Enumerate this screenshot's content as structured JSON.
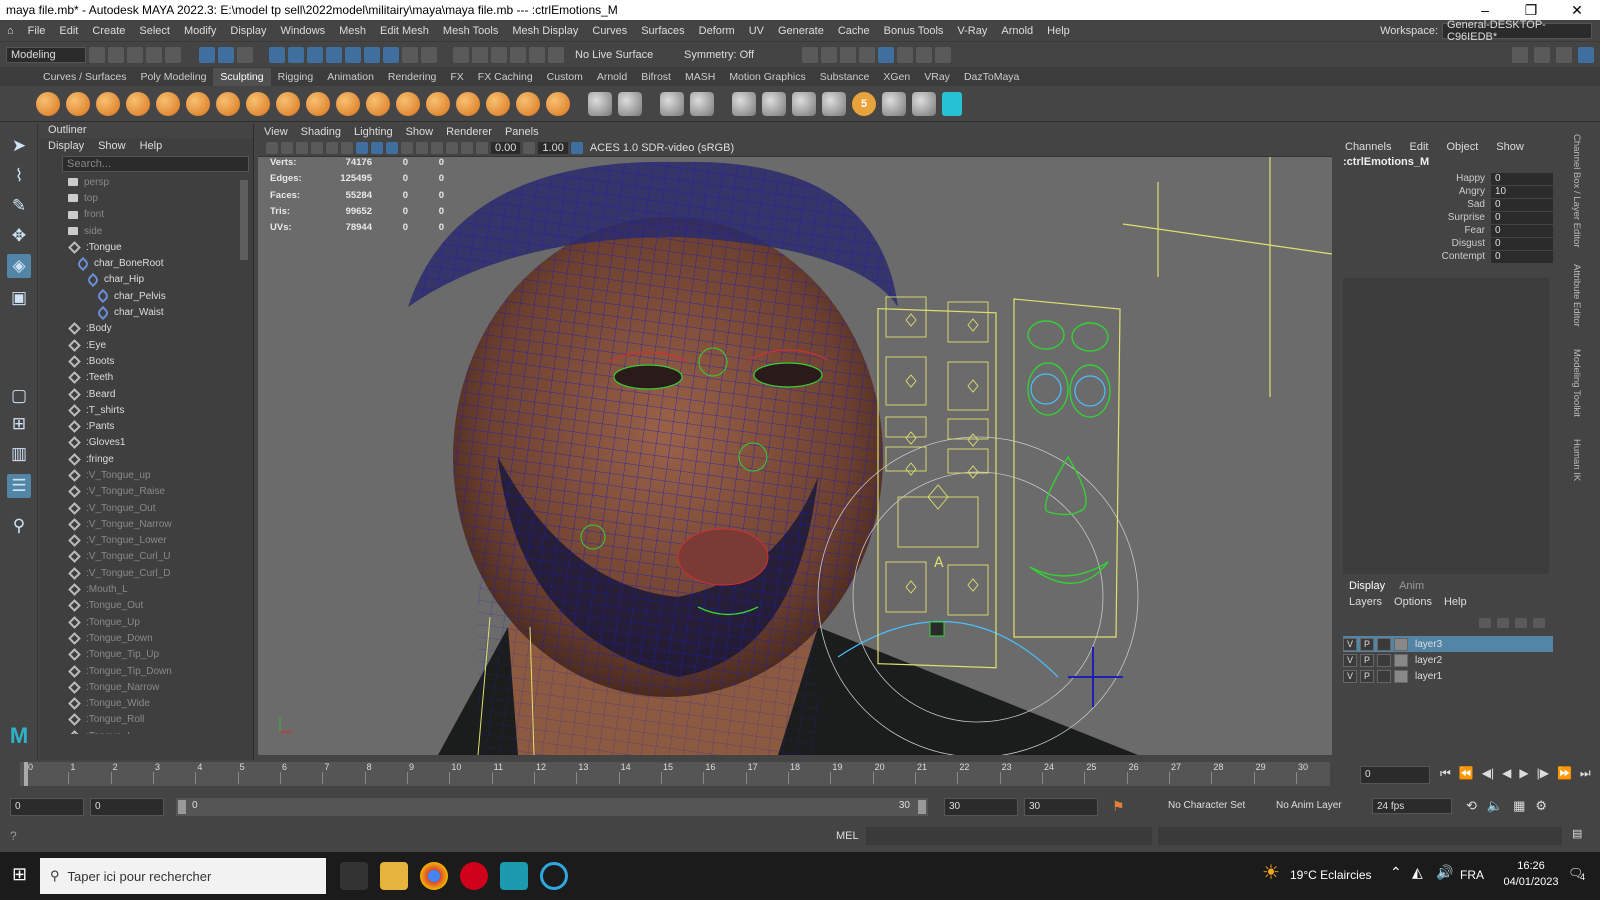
{
  "window": {
    "title": "maya file.mb* - Autodesk MAYA 2022.3: E:\\model tp sell\\2022model\\militairy\\maya\\maya file.mb   ---   :ctrlEmotions_M"
  },
  "menu": [
    "File",
    "Edit",
    "Create",
    "Select",
    "Modify",
    "Display",
    "Windows",
    "Mesh",
    "Edit Mesh",
    "Mesh Tools",
    "Mesh Display",
    "Curves",
    "Surfaces",
    "Deform",
    "UV",
    "Generate",
    "Cache",
    "Bonus Tools",
    "V-Ray",
    "Arnold",
    "Help"
  ],
  "workspace": {
    "label": "Workspace:",
    "value": "General-DESKTOP-C96IEDB*"
  },
  "status": {
    "mode": "Modeling",
    "live_surface": "No Live Surface",
    "symmetry": "Symmetry: Off"
  },
  "shelf_tabs": [
    "Curves / Surfaces",
    "Poly Modeling",
    "Sculpting",
    "Rigging",
    "Animation",
    "Rendering",
    "FX",
    "FX Caching",
    "Custom",
    "Arnold",
    "Bifrost",
    "MASH",
    "Motion Graphics",
    "Substance",
    "XGen",
    "VRay",
    "DazToMaya"
  ],
  "outliner": {
    "title": "Outliner",
    "menu": [
      "Display",
      "Show",
      "Help"
    ],
    "search_placeholder": "Search...",
    "items": [
      {
        "label": "persp",
        "icon": "camera-icon",
        "dim": true,
        "indent": 0
      },
      {
        "label": "top",
        "icon": "camera-icon",
        "dim": true,
        "indent": 0
      },
      {
        "label": "front",
        "icon": "camera-icon",
        "dim": true,
        "indent": 0
      },
      {
        "label": "side",
        "icon": "camera-icon",
        "dim": true,
        "indent": 0
      },
      {
        "label": ":Tongue",
        "icon": "mesh-icon",
        "dim": false,
        "indent": 0
      },
      {
        "label": "char_BoneRoot",
        "icon": "joint-icon",
        "dim": false,
        "indent": 1
      },
      {
        "label": "char_Hip",
        "icon": "joint-icon",
        "dim": false,
        "indent": 2
      },
      {
        "label": "char_Pelvis",
        "icon": "joint-icon",
        "dim": false,
        "indent": 3
      },
      {
        "label": "char_Waist",
        "icon": "joint-icon",
        "dim": false,
        "indent": 3
      },
      {
        "label": ":Body",
        "icon": "mesh-icon",
        "dim": false,
        "indent": 0
      },
      {
        "label": ":Eye",
        "icon": "mesh-icon",
        "dim": false,
        "indent": 0
      },
      {
        "label": ":Boots",
        "icon": "mesh-icon",
        "dim": false,
        "indent": 0
      },
      {
        "label": ":Teeth",
        "icon": "mesh-icon",
        "dim": false,
        "indent": 0
      },
      {
        "label": ":Beard",
        "icon": "mesh-icon",
        "dim": false,
        "indent": 0
      },
      {
        "label": ":T_shirts",
        "icon": "mesh-icon",
        "dim": false,
        "indent": 0
      },
      {
        "label": ":Pants",
        "icon": "mesh-icon",
        "dim": false,
        "indent": 0
      },
      {
        "label": ":Gloves1",
        "icon": "mesh-icon",
        "dim": false,
        "indent": 0
      },
      {
        "label": ":fringe",
        "icon": "mesh-icon",
        "dim": false,
        "indent": 0
      },
      {
        "label": ":V_Tongue_up",
        "icon": "mesh-icon",
        "dim": true,
        "indent": 0
      },
      {
        "label": ":V_Tongue_Raise",
        "icon": "mesh-icon",
        "dim": true,
        "indent": 0
      },
      {
        "label": ":V_Tongue_Out",
        "icon": "mesh-icon",
        "dim": true,
        "indent": 0
      },
      {
        "label": ":V_Tongue_Narrow",
        "icon": "mesh-icon",
        "dim": true,
        "indent": 0
      },
      {
        "label": ":V_Tongue_Lower",
        "icon": "mesh-icon",
        "dim": true,
        "indent": 0
      },
      {
        "label": ":V_Tongue_Curl_U",
        "icon": "mesh-icon",
        "dim": true,
        "indent": 0
      },
      {
        "label": ":V_Tongue_Curl_D",
        "icon": "mesh-icon",
        "dim": true,
        "indent": 0
      },
      {
        "label": ":Mouth_L",
        "icon": "mesh-icon",
        "dim": true,
        "indent": 0
      },
      {
        "label": ":Tongue_Out",
        "icon": "mesh-icon",
        "dim": true,
        "indent": 0
      },
      {
        "label": ":Tongue_Up",
        "icon": "mesh-icon",
        "dim": true,
        "indent": 0
      },
      {
        "label": ":Tongue_Down",
        "icon": "mesh-icon",
        "dim": true,
        "indent": 0
      },
      {
        "label": ":Tongue_Tip_Up",
        "icon": "mesh-icon",
        "dim": true,
        "indent": 0
      },
      {
        "label": ":Tongue_Tip_Down",
        "icon": "mesh-icon",
        "dim": true,
        "indent": 0
      },
      {
        "label": ":Tongue_Narrow",
        "icon": "mesh-icon",
        "dim": true,
        "indent": 0
      },
      {
        "label": ":Tongue_Wide",
        "icon": "mesh-icon",
        "dim": true,
        "indent": 0
      },
      {
        "label": ":Tongue_Roll",
        "icon": "mesh-icon",
        "dim": true,
        "indent": 0
      },
      {
        "label": ":Tongue_L",
        "icon": "mesh-icon",
        "dim": true,
        "indent": 0
      }
    ]
  },
  "viewport": {
    "menu": [
      "View",
      "Shading",
      "Lighting",
      "Show",
      "Renderer",
      "Panels"
    ],
    "exposure": "0.00",
    "gamma": "1.00",
    "colorspace": "ACES 1.0 SDR-video (sRGB)",
    "hud": [
      {
        "label": "Verts:",
        "value": "74176",
        "a": "0",
        "b": "0"
      },
      {
        "label": "Edges:",
        "value": "125495",
        "a": "0",
        "b": "0"
      },
      {
        "label": "Faces:",
        "value": "55284",
        "a": "0",
        "b": "0"
      },
      {
        "label": "Tris:",
        "value": "99652",
        "a": "0",
        "b": "0"
      },
      {
        "label": "UVs:",
        "value": "78944",
        "a": "0",
        "b": "0"
      }
    ]
  },
  "channelbox": {
    "menu": [
      "Channels",
      "Edit",
      "Object",
      "Show"
    ],
    "object": ":ctrlEmotions_M",
    "attrs": [
      {
        "name": "Happy",
        "value": "0"
      },
      {
        "name": "Angry",
        "value": "10"
      },
      {
        "name": "Sad",
        "value": "0"
      },
      {
        "name": "Surprise",
        "value": "0"
      },
      {
        "name": "Fear",
        "value": "0"
      },
      {
        "name": "Disgust",
        "value": "0"
      },
      {
        "name": "Contempt",
        "value": "0"
      }
    ]
  },
  "layers": {
    "tabs": [
      "Display",
      "Anim"
    ],
    "menu": [
      "Layers",
      "Options",
      "Help"
    ],
    "rows": [
      {
        "v": "V",
        "p": "P",
        "name": "layer3",
        "selected": true
      },
      {
        "v": "V",
        "p": "P",
        "name": "layer2",
        "selected": false
      },
      {
        "v": "V",
        "p": "P",
        "name": "layer1",
        "selected": false
      }
    ]
  },
  "side_tabs": [
    "Channel Box / Layer Editor",
    "Attribute Editor",
    "Modeling Toolkit",
    "Human IK"
  ],
  "timeline": {
    "ticks": [
      "0",
      "1",
      "2",
      "3",
      "4",
      "5",
      "6",
      "7",
      "8",
      "9",
      "10",
      "11",
      "12",
      "13",
      "14",
      "15",
      "16",
      "17",
      "18",
      "19",
      "20",
      "21",
      "22",
      "23",
      "24",
      "25",
      "26",
      "27",
      "28",
      "29",
      "30"
    ],
    "current_frame": "0",
    "range_start": "0",
    "range_start2": "0",
    "slider_start": "0",
    "slider_end": "30",
    "range_end": "30",
    "range_end2": "30",
    "character_set": "No Character Set",
    "anim_layer": "No Anim Layer",
    "fps": "24 fps"
  },
  "cmdline": {
    "label": "MEL"
  },
  "taskbar": {
    "search": "Taper ici pour rechercher",
    "weather": "19°C  Eclaircies",
    "lang": "FRA",
    "time": "16:26",
    "date": "04/01/2023",
    "notif": "4"
  },
  "colors": {
    "accent": "#5285a6",
    "wire": "#1a1aa8",
    "ctrl": "#e0e070",
    "ctrl_green": "#35d035"
  }
}
